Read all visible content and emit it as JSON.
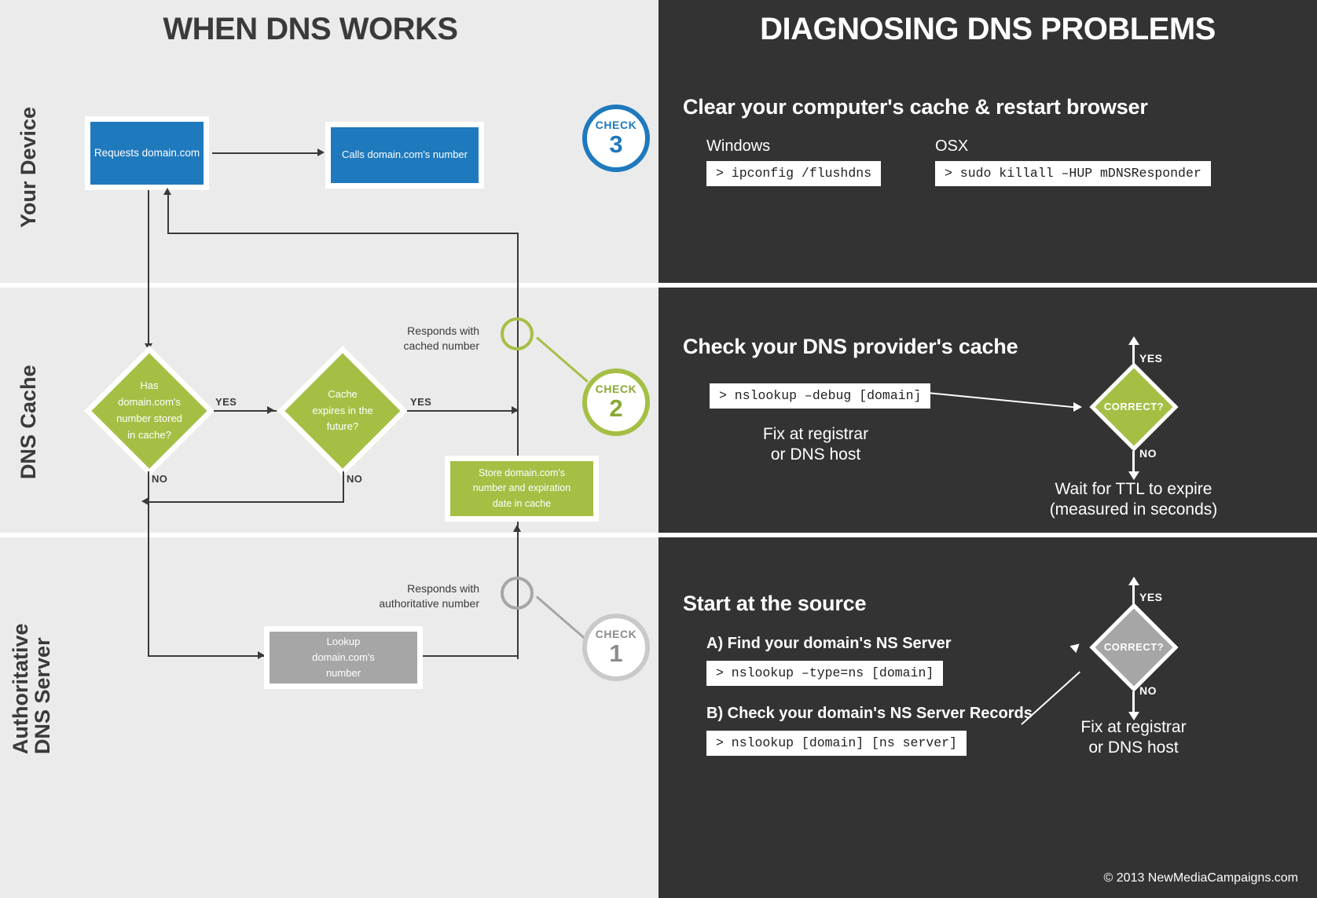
{
  "headers": {
    "left": "WHEN DNS WORKS",
    "right": "DIAGNOSING DNS PROBLEMS"
  },
  "lanes": [
    {
      "label": "Your Device"
    },
    {
      "label": "DNS Cache"
    },
    {
      "label": "Authoritative\nDNS Server"
    }
  ],
  "lane_labels": {
    "device": "Your Device",
    "cache": "DNS Cache",
    "auth_line1": "Authoritative",
    "auth_line2": "DNS Server"
  },
  "flow": {
    "requests_box": "Requests domain.com",
    "calls_box": "Calls domain.com's number",
    "has_cache_diamond": "Has domain.com's number stored in cache?",
    "has_cache_lines": [
      "Has",
      "domain.com's",
      "number stored",
      "in cache?"
    ],
    "cache_expires_diamond": "Cache expires in the future?",
    "cache_expires_lines": [
      "Cache",
      "expires in the",
      "future?"
    ],
    "store_box_lines": [
      "Store domain.com's",
      "number and expiration",
      "date in cache"
    ],
    "lookup_box_lines": [
      "Lookup",
      "domain.com's",
      "number"
    ],
    "yes_1": "YES",
    "yes_2": "YES",
    "no_1": "NO",
    "no_2": "NO",
    "responds_cached": [
      "Responds with",
      "cached number"
    ],
    "responds_auth": [
      "Responds with",
      "authoritative number"
    ]
  },
  "badges": [
    {
      "word": "CHECK",
      "number": "3",
      "color": "#1f79bd"
    },
    {
      "word": "CHECK",
      "number": "2",
      "color": "#a5bf45"
    },
    {
      "word": "CHECK",
      "number": "1",
      "color": "#c9c9c9"
    }
  ],
  "right": {
    "check3": {
      "title": "Clear your computer's cache & restart browser",
      "windows_label": "Windows",
      "windows_cmd": "> ipconfig /flushdns",
      "osx_label": "OSX",
      "osx_cmd": "> sudo killall –HUP mDNSResponder"
    },
    "check2": {
      "title": "Check your DNS provider's cache",
      "cmd": "> nslookup –debug [domain]",
      "fix_note": [
        "Fix at registrar",
        "or DNS host"
      ],
      "diamond": "CORRECT?",
      "yes": "YES",
      "no": "NO",
      "no_outcome": [
        "Wait for TTL to expire",
        "(measured in seconds)"
      ]
    },
    "check1": {
      "title": "Start at the source",
      "step_a_label": "A) Find your domain's NS Server",
      "step_a_cmd": "> nslookup –type=ns [domain]",
      "step_b_label": "B) Check your domain's NS Server Records",
      "step_b_cmd": "> nslookup [domain] [ns server]",
      "diamond": "CORRECT?",
      "yes": "YES",
      "no": "NO",
      "no_outcome": [
        "Fix at registrar",
        "or DNS host"
      ]
    }
  },
  "footer": "© 2013 NewMediaCampaigns.com",
  "colors": {
    "bg_left": "#ebebeb",
    "bg_right": "#333333",
    "blue": "#1f79bd",
    "green": "#a5bf45",
    "grey": "#a6a6a6",
    "dark_text": "#3a3a3a"
  }
}
